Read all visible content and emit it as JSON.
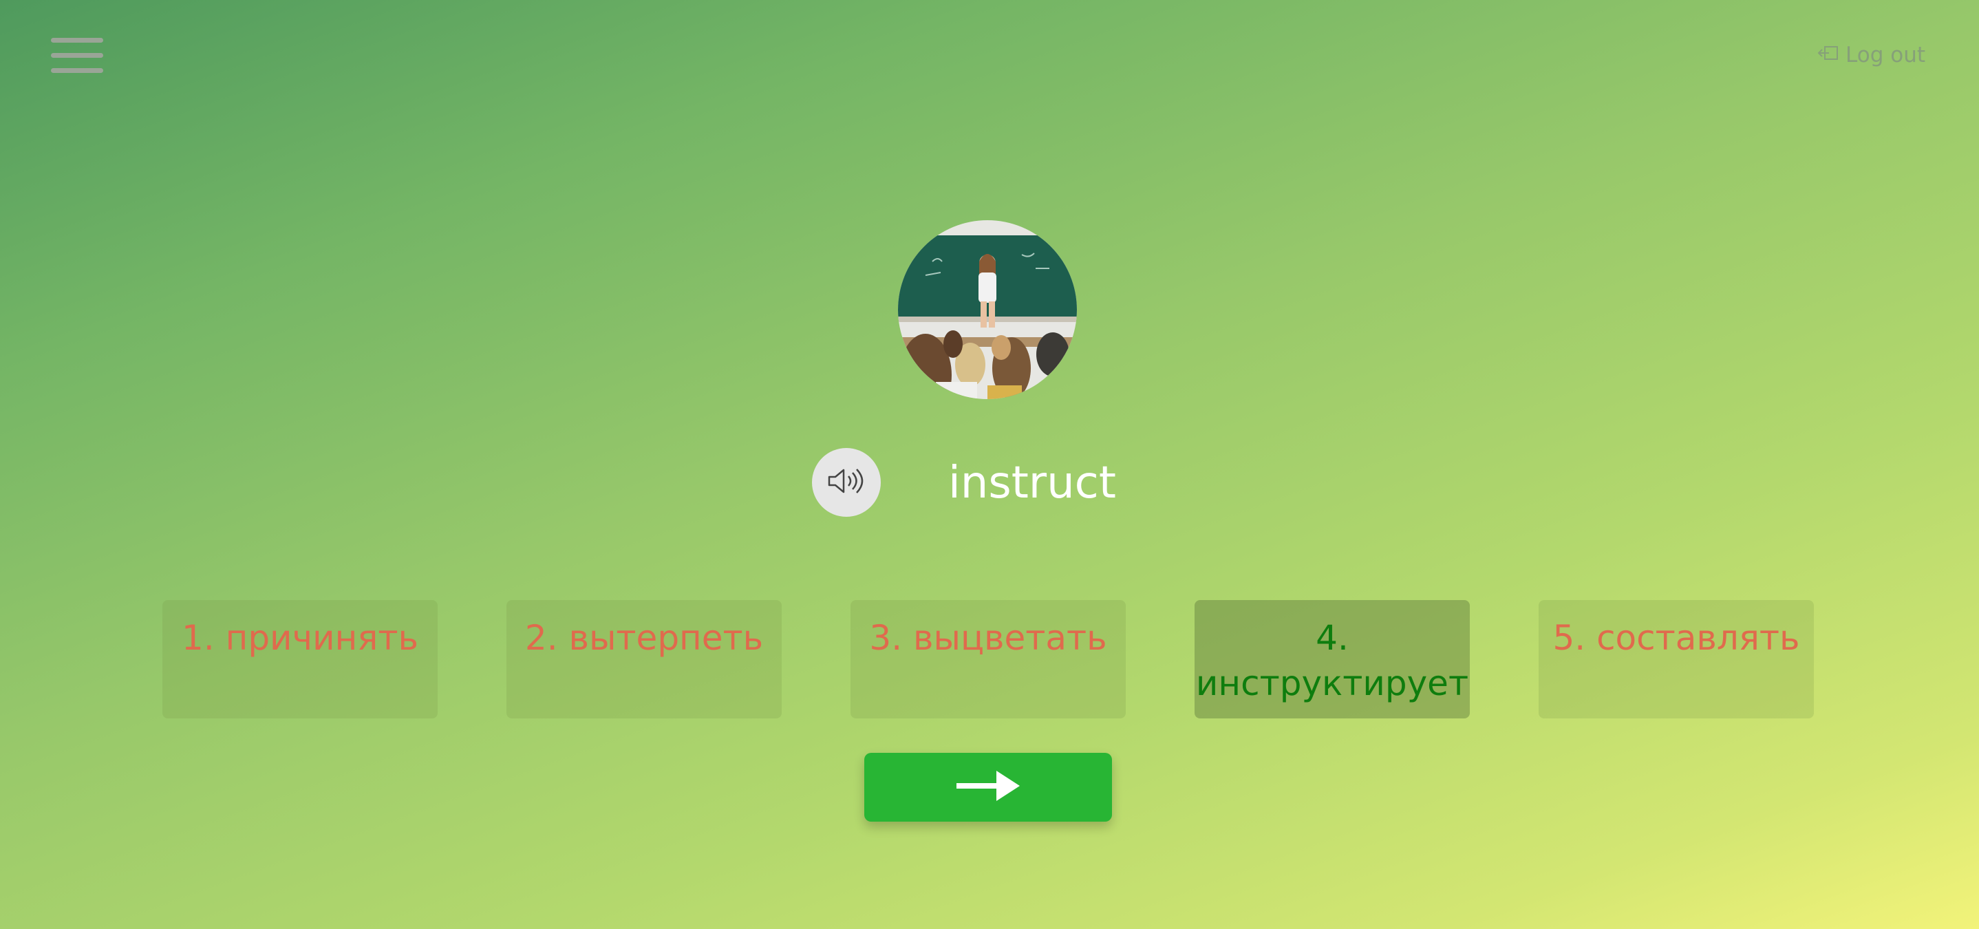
{
  "header": {
    "menu_icon": "hamburger-menu-icon",
    "logout_icon": "logout-icon",
    "logout_label": "Log out"
  },
  "card": {
    "picture_icon": "classroom-teacher-photo",
    "sound_icon": "speaker-icon",
    "word": "instruct"
  },
  "options": [
    {
      "label": "1. причинять",
      "state": "wrong"
    },
    {
      "label": "2. вытерпеть",
      "state": "wrong"
    },
    {
      "label": "3. выцветать",
      "state": "wrong"
    },
    {
      "label": "4. инструктирует",
      "state": "correct"
    },
    {
      "label": "5. составлять",
      "state": "wrong"
    }
  ],
  "next": {
    "icon": "arrow-right-icon"
  },
  "colors": {
    "wrong_text": "#e06a4d",
    "correct_text": "#0e7d0e",
    "next_button": "#28b534"
  }
}
